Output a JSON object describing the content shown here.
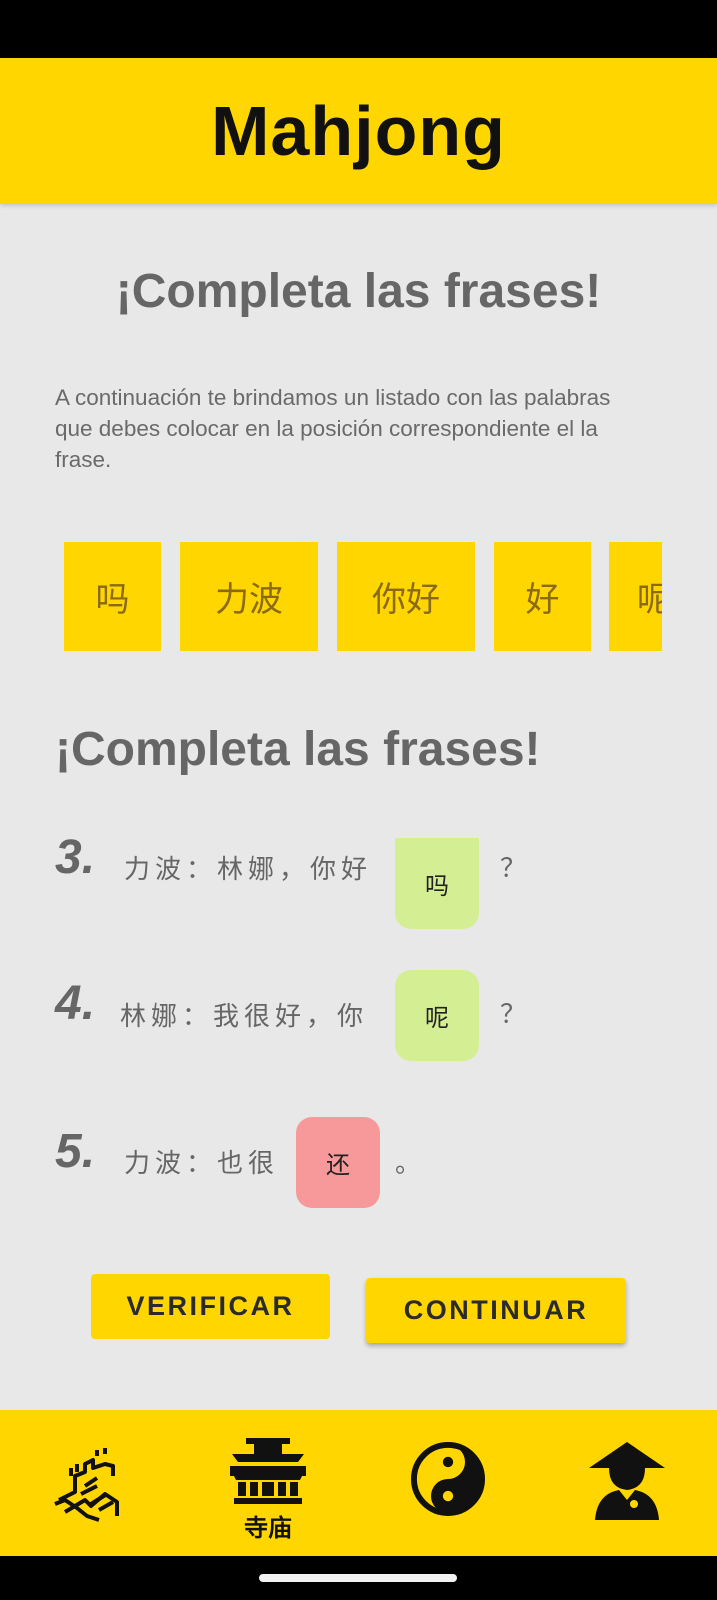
{
  "app": {
    "title": "Mahjong"
  },
  "main": {
    "title": "¡Completa las frases!",
    "intro": "A continuación te brindamos un listado con las palabras que debes colocar en la posición correspondiente el la frase.",
    "word_bank": [
      "吗",
      "力波",
      "你好",
      "好",
      "呢"
    ],
    "subtitle": "¡Completa las frases!",
    "sentences": [
      {
        "number": "3.",
        "text": "力波：林娜，你好",
        "answer": "吗",
        "status": "correct",
        "end": "？"
      },
      {
        "number": "4.",
        "text": "林娜：我很好，你",
        "answer": "呢",
        "status": "correct",
        "end": "？"
      },
      {
        "number": "5.",
        "text": "力波：也很",
        "answer": "还",
        "status": "incorrect",
        "end": "。"
      }
    ],
    "buttons": {
      "verify": "VERIFICAR",
      "continue": "CONTINUAR"
    }
  },
  "bottom_nav": {
    "items": [
      {
        "icon": "great-wall-icon",
        "label": ""
      },
      {
        "icon": "temple-icon",
        "label": "寺庙"
      },
      {
        "icon": "yin-yang-icon",
        "label": ""
      },
      {
        "icon": "monk-icon",
        "label": ""
      }
    ]
  },
  "colors": {
    "accent": "#ffd600",
    "correct": "#d4ef93",
    "incorrect": "#f7999a",
    "background": "#e8e8e8"
  }
}
